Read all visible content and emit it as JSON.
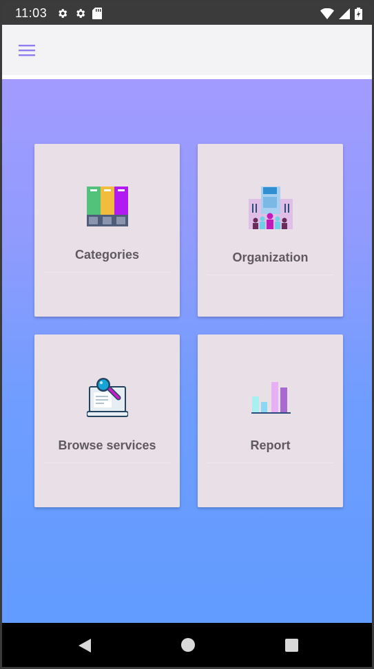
{
  "status_bar": {
    "time": "11:03",
    "icons_left": [
      "settings-icon",
      "settings-icon",
      "sd-card-icon"
    ],
    "icons_right": [
      "wifi-icon",
      "signal-icon",
      "battery-icon"
    ]
  },
  "app_bar": {
    "menu_icon": "hamburger-menu-icon",
    "accent_color": "#8e7cf0"
  },
  "background": {
    "gradient_top": "#a39bff",
    "gradient_bottom": "#619cfe"
  },
  "cards": [
    {
      "label": "Categories",
      "icon": "folders-icon"
    },
    {
      "label": "Organization",
      "icon": "organization-building-icon"
    },
    {
      "label": "Browse services",
      "icon": "browse-laptop-search-icon"
    },
    {
      "label": "Report",
      "icon": "bar-chart-icon"
    }
  ],
  "nav_bar": {
    "buttons": [
      "back-icon",
      "home-icon",
      "recent-apps-icon"
    ]
  }
}
